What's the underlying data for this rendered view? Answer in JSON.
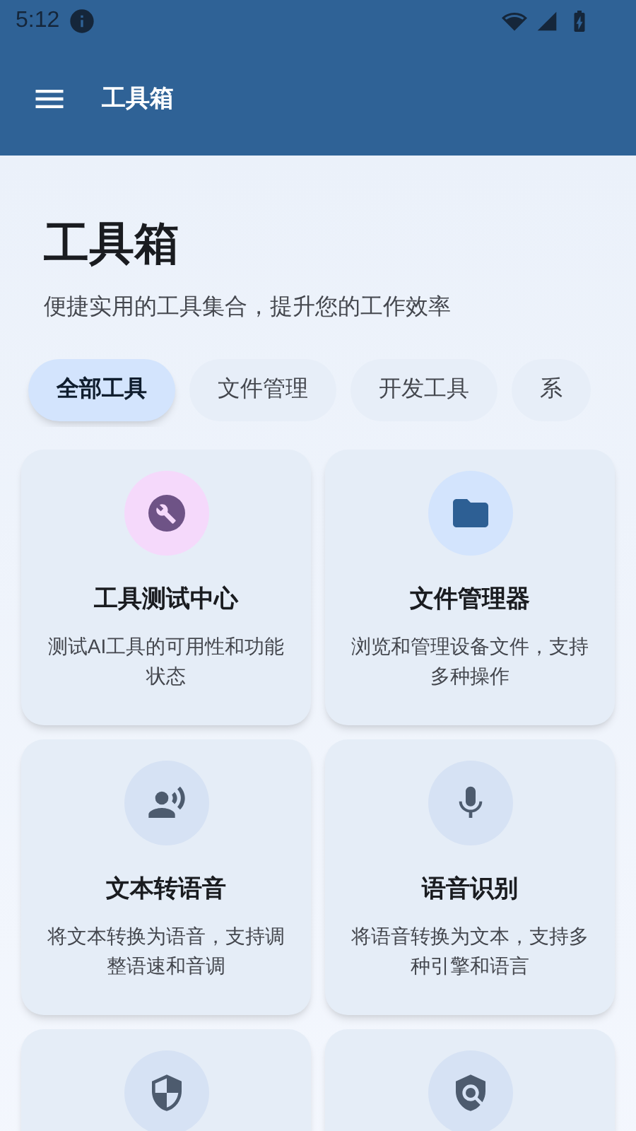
{
  "status_bar": {
    "time": "5:12"
  },
  "app_bar": {
    "title": "工具箱"
  },
  "header": {
    "title": "工具箱",
    "subtitle": "便捷实用的工具集合，提升您的工作效率"
  },
  "tabs": [
    {
      "label": "全部工具",
      "selected": true
    },
    {
      "label": "文件管理",
      "selected": false
    },
    {
      "label": "开发工具",
      "selected": false
    },
    {
      "label": "系",
      "selected": false
    }
  ],
  "tools": [
    {
      "kind": "wrench",
      "color": "#f5d9fb",
      "title": "工具测试中心",
      "description": "测试AI工具的可用性和功能状态"
    },
    {
      "kind": "folder",
      "color": "#d3e4fd",
      "title": "文件管理器",
      "description": "浏览和管理设备文件，支持多种操作"
    },
    {
      "kind": "voice",
      "color": "#d6e2f4",
      "title": "文本转语音",
      "description": "将文本转换为语音，支持调整语速和音调"
    },
    {
      "kind": "mic",
      "color": "#d6e2f4",
      "title": "语音识别",
      "description": "将语音转换为文本，支持多种引擎和语言"
    },
    {
      "kind": "shield",
      "color": "#d6e2f4"
    },
    {
      "kind": "policy",
      "color": "#d6e2f4"
    }
  ]
}
